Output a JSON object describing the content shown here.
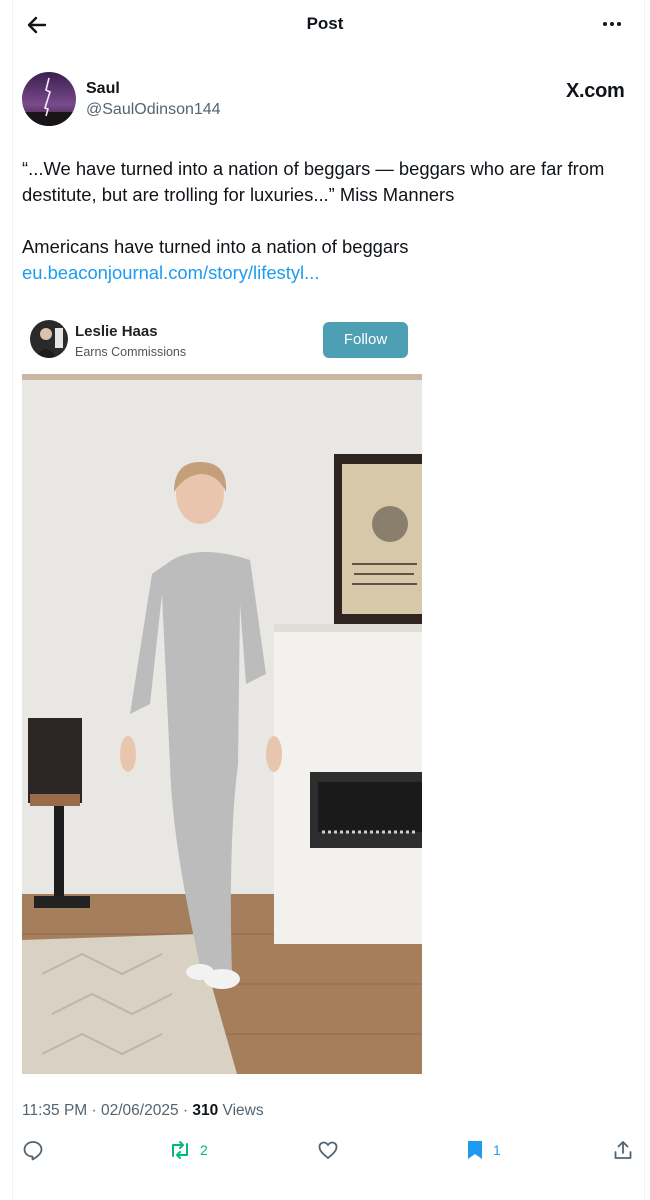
{
  "header": {
    "title": "Post"
  },
  "author": {
    "display_name": "Saul",
    "handle": "@SaulOdinson144",
    "source": "X.com"
  },
  "tweet": {
    "line1": "“...We have turned into a nation of beggars — beggars who are far from destitute, but are trolling for luxuries...” Miss Manners",
    "line2": "Americans have turned into a nation of beggars",
    "link": "eu.beaconjournal.com/story/lifestyl..."
  },
  "embed": {
    "name": "Leslie Haas",
    "subtitle": "Earns Commissions",
    "follow_label": "Follow"
  },
  "meta": {
    "time": "11:35 PM",
    "date": "02/06/2025",
    "views_count": "310",
    "views_label": "Views"
  },
  "actions": {
    "retweets": "2",
    "bookmarks": "1"
  },
  "icons": [
    "back-arrow-icon",
    "more-icon",
    "reply-icon",
    "retweet-icon",
    "like-icon",
    "bookmark-icon",
    "share-icon"
  ],
  "colors": {
    "link": "#1d9bf0",
    "retweet": "#00ba7c",
    "bookmark": "#1d9bf0",
    "follow_button": "#4d9fb4",
    "secondary_text": "#536471"
  }
}
